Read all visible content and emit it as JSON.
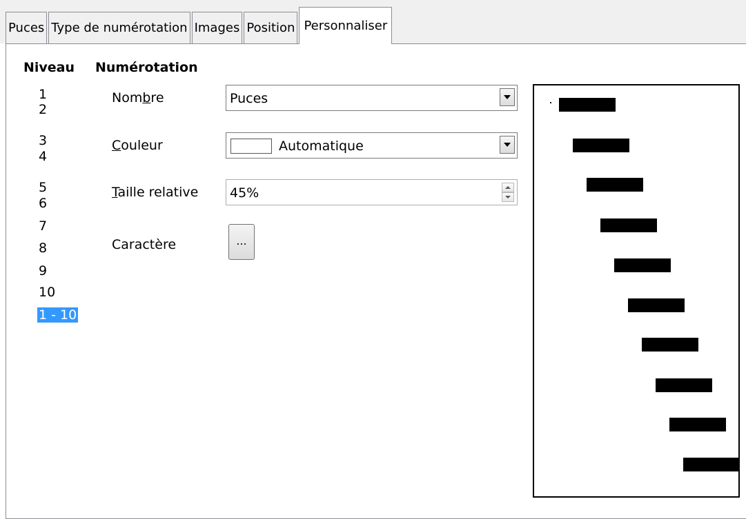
{
  "tabs": [
    {
      "label": "Puces",
      "active": false
    },
    {
      "label": "Type de numérotation",
      "active": false
    },
    {
      "label": "Images",
      "active": false
    },
    {
      "label": "Position",
      "active": false
    },
    {
      "label": "Personnaliser",
      "active": true
    }
  ],
  "headings": {
    "level": "Niveau",
    "numbering": "Numérotation"
  },
  "levels": {
    "items": [
      "1",
      "2",
      "3",
      "4",
      "5",
      "6",
      "7",
      "8",
      "9",
      "10",
      "1 - 10"
    ],
    "selected": "1 - 10"
  },
  "fields": {
    "number": {
      "label_pre": "Nom",
      "label_u": "b",
      "label_post": "re",
      "value": "Puces"
    },
    "color": {
      "label_u": "C",
      "label_post": "ouleur",
      "value": "Automatique",
      "swatch_color": "#ffffff"
    },
    "relative_size": {
      "label_u": "T",
      "label_post": "aille relative",
      "value": "45%"
    },
    "character": {
      "label": "Caractère",
      "button_label": "..."
    }
  },
  "colors": {
    "selection": "#3399ff",
    "tab_border": "#898c95",
    "dialog_bg": "#f0f0f0"
  }
}
